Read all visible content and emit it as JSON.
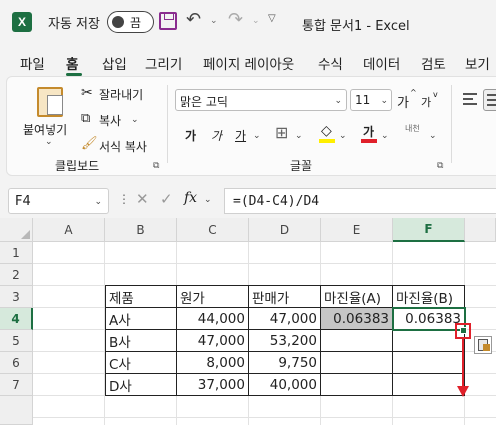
{
  "titlebar": {
    "app_logo": "X",
    "autosave_label": "자동 저장",
    "autosave_state": "끔",
    "document_title": "통합 문서1  -  Excel",
    "icons": [
      "excel-logo-icon",
      "save-icon",
      "undo-icon",
      "redo-icon",
      "customize-qat-icon"
    ]
  },
  "tabs": [
    {
      "label": "파일"
    },
    {
      "label": "홈",
      "active": true
    },
    {
      "label": "삽입"
    },
    {
      "label": "그리기"
    },
    {
      "label": "페이지 레이아웃"
    },
    {
      "label": "수식"
    },
    {
      "label": "데이터"
    },
    {
      "label": "검토"
    },
    {
      "label": "보기"
    }
  ],
  "ribbon": {
    "clipboard": {
      "paste": "붙여넣기",
      "cut": "잘라내기",
      "copy": "복사",
      "format_painter": "서식 복사",
      "group_label": "클립보드"
    },
    "font": {
      "font_name": "맑은 고딕",
      "font_size": "11",
      "grow": "가",
      "shrink": "가",
      "bold": "가",
      "italic": "가",
      "underline": "가",
      "color_text": "가",
      "phonetic": "내천",
      "group_label": "글꼴",
      "colors": {
        "fill": "#ffef00",
        "font": "#e0202a"
      }
    }
  },
  "formula_bar": {
    "name_box": "F4",
    "fx": "fx",
    "formula": "=(D4-C4)/D4"
  },
  "grid": {
    "columns": [
      "A",
      "B",
      "C",
      "D",
      "E",
      "F"
    ],
    "rows": [
      "1",
      "2",
      "3",
      "4",
      "5",
      "6",
      "7"
    ],
    "selected_column": "E",
    "selected_row": "4",
    "table": {
      "headers": [
        "제품",
        "원가",
        "판매가",
        "마진율(A)",
        "마진율(B)"
      ],
      "rows": [
        [
          "A사",
          "44,000",
          "47,000",
          "0.06383",
          "0.06383"
        ],
        [
          "B사",
          "47,000",
          "53,200",
          "",
          ""
        ],
        [
          "C사",
          "8,000",
          "9,750",
          "",
          ""
        ],
        [
          "D사",
          "37,000",
          "40,000",
          "",
          ""
        ]
      ]
    },
    "annotation_color": "#e0202a",
    "selection_color": "#1d6f42"
  }
}
